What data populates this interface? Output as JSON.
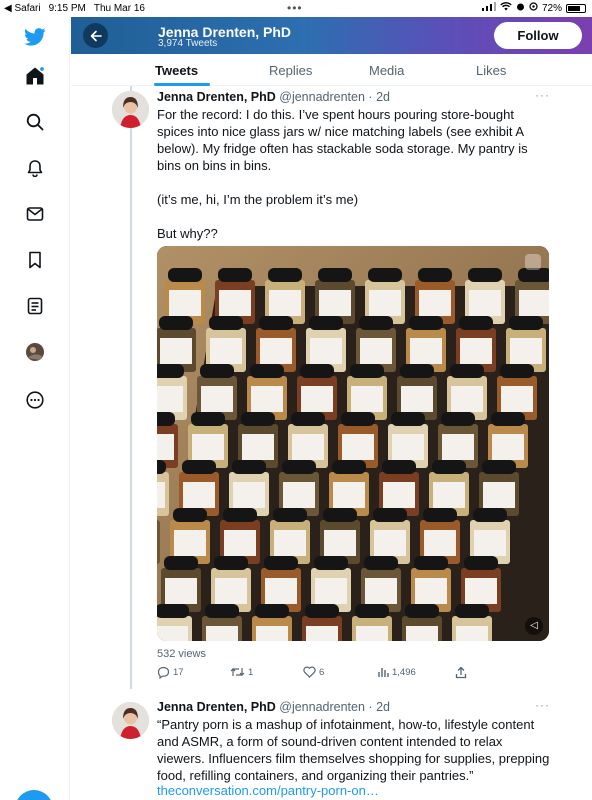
{
  "status_bar": {
    "back_app": "◀ Safari",
    "time": "9:15 PM",
    "date": "Thu Mar 16",
    "battery": "72%"
  },
  "header": {
    "name": "Jenna Drenten, PhD",
    "tweet_count": "3,974 Tweets",
    "follow_label": "Follow"
  },
  "tabs": [
    {
      "label": "Tweets"
    },
    {
      "label": "Replies"
    },
    {
      "label": "Media"
    },
    {
      "label": "Likes"
    }
  ],
  "sidebar": {
    "icons": [
      "twitter-logo-icon",
      "home-icon",
      "search-icon",
      "notifications-icon",
      "messages-icon",
      "bookmarks-icon",
      "lists-icon",
      "profile-avatar-icon",
      "more-icon"
    ]
  },
  "tweet1": {
    "name": "Jenna Drenten, PhD",
    "handle": "@jennadrenten",
    "time": "2d",
    "text": "For the record: I do this. I’ve spent hours pouring store-bought spices into nice glass jars w/ nice matching labels (see exhibit A below). My fridge often has stackable soda storage. My pantry is bins on bins in bins.\n\n(it’s me, hi, I’m the problem it’s me)\n\nBut why??",
    "views": "532 views",
    "replies": "17",
    "retweets": "1",
    "likes": "6",
    "analytics": "1,496"
  },
  "tweet2": {
    "name": "Jenna Drenten, PhD",
    "handle": "@jennadrenten",
    "time": "2d",
    "text": "“Pantry porn is a mashup of infotainment, how-to, lifestyle content and ASMR, a form of sound-driven content intended to relax viewers. Influencers film themselves shopping for supplies, prepping food, refilling containers, and organizing their pantries.”",
    "link": "theconversation.com/pantry-porn-on…"
  },
  "colors": {
    "accent": "#1d9bf0",
    "text": "#0f1419",
    "muted": "#536471"
  }
}
